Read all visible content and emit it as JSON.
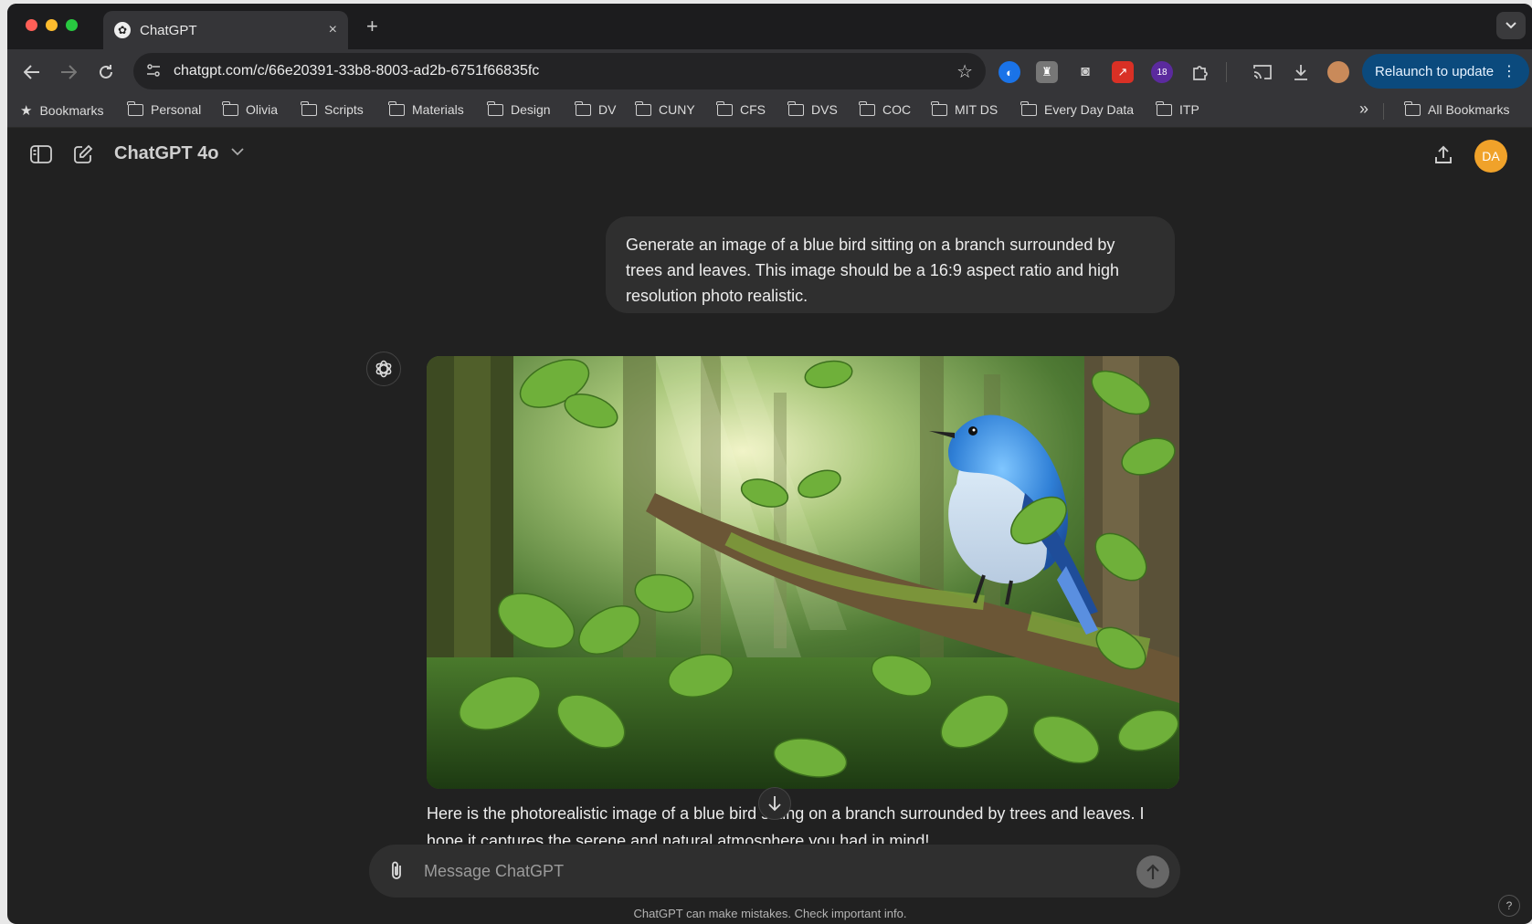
{
  "browser": {
    "tab_title": "ChatGPT",
    "tab_close": "×",
    "new_tab": "+",
    "url": "chatgpt.com/c/66e20391-33b8-8003-ad2b-6751f66835fc",
    "extension_badge": "18",
    "relaunch_label": "Relaunch to update",
    "bookmarks": {
      "bookmarks_label": "Bookmarks",
      "folders": [
        "Personal",
        "Olivia",
        "Scripts",
        "Materials",
        "Design",
        "DV",
        "CUNY",
        "CFS",
        "DVS",
        "COC",
        "MIT DS",
        "Every Day Data",
        "ITP"
      ],
      "overflow": "»",
      "all_bookmarks": "All Bookmarks"
    }
  },
  "app": {
    "model_name": "ChatGPT 4o",
    "avatar_initials": "DA"
  },
  "chat": {
    "user_message": "Generate an image of a blue bird sitting on a branch surrounded by trees and leaves. This image should be a 16:9 aspect ratio and high resolution photo realistic.",
    "assistant_reply": "Here is the photorealistic image of a blue bird sitting on a branch surrounded by trees and leaves. I hope it captures the serene and natural atmosphere you had in mind!"
  },
  "composer": {
    "placeholder": "Message ChatGPT"
  },
  "footer": {
    "disclaimer": "ChatGPT can make mistakes. Check important info.",
    "help": "?"
  },
  "colors": {
    "background": "#212121",
    "bubble": "#2f2f2f",
    "relaunch": "#0b4a7d",
    "avatar": "#f0a22a"
  }
}
